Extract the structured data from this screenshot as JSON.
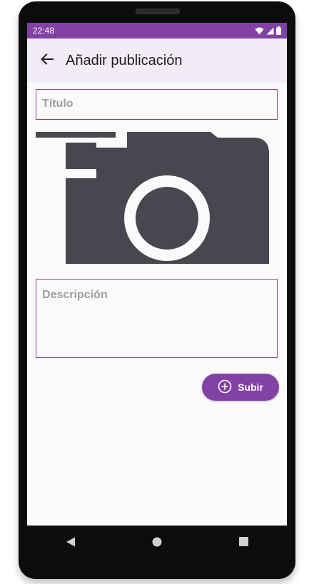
{
  "status_bar": {
    "time": "22:48",
    "icons": [
      "wifi-icon",
      "signal-icon",
      "battery-icon"
    ]
  },
  "toolbar": {
    "back_icon": "arrow-back-icon",
    "title": "Añadir publicación"
  },
  "form": {
    "title_placeholder": "Título",
    "image_icon": "camera-icon",
    "description_placeholder": "Descripción",
    "submit_label": "Subir",
    "submit_icon": "plus-circle-icon"
  },
  "nav_bar": {
    "icons": [
      "back-triangle-icon",
      "home-circle-icon",
      "recents-square-icon"
    ]
  },
  "colors": {
    "primary": "#8241a4",
    "toolbar_bg": "#f1ecf5",
    "camera_fill": "#4a4650",
    "placeholder": "#9e9e9e"
  }
}
